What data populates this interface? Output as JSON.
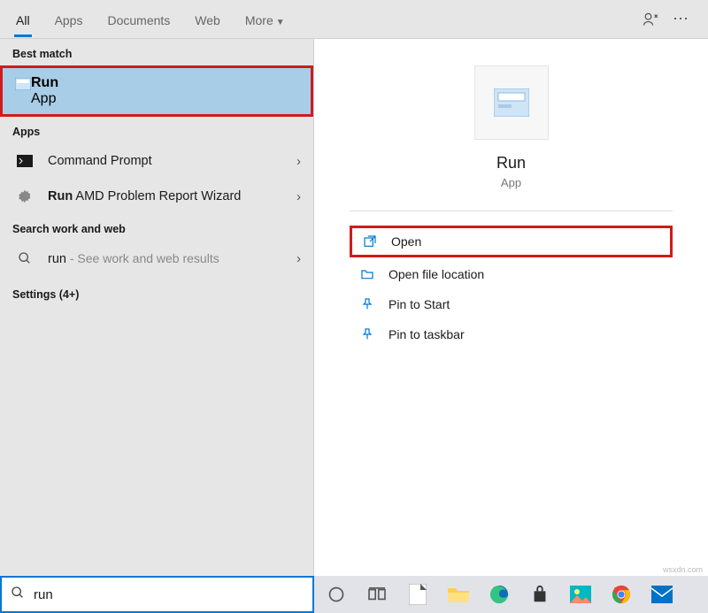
{
  "tabs": {
    "all": "All",
    "apps": "Apps",
    "documents": "Documents",
    "web": "Web",
    "more": "More"
  },
  "sections": {
    "best_match": "Best match",
    "apps": "Apps",
    "search_work_web": "Search work and web",
    "settings": "Settings (4+)"
  },
  "best_match": {
    "title": "Run",
    "subtitle": "App"
  },
  "apps_results": {
    "command_prompt": "Command Prompt",
    "run_bold": "Run",
    "run_rest": " AMD Problem Report Wizard"
  },
  "web_result": {
    "query": "run",
    "hint": " - See work and web results"
  },
  "preview": {
    "title": "Run",
    "type": "App"
  },
  "actions": {
    "open": "Open",
    "open_file_location": "Open file location",
    "pin_start": "Pin to Start",
    "pin_taskbar": "Pin to taskbar"
  },
  "search_value": "run",
  "attribution": "wsxdn.com"
}
